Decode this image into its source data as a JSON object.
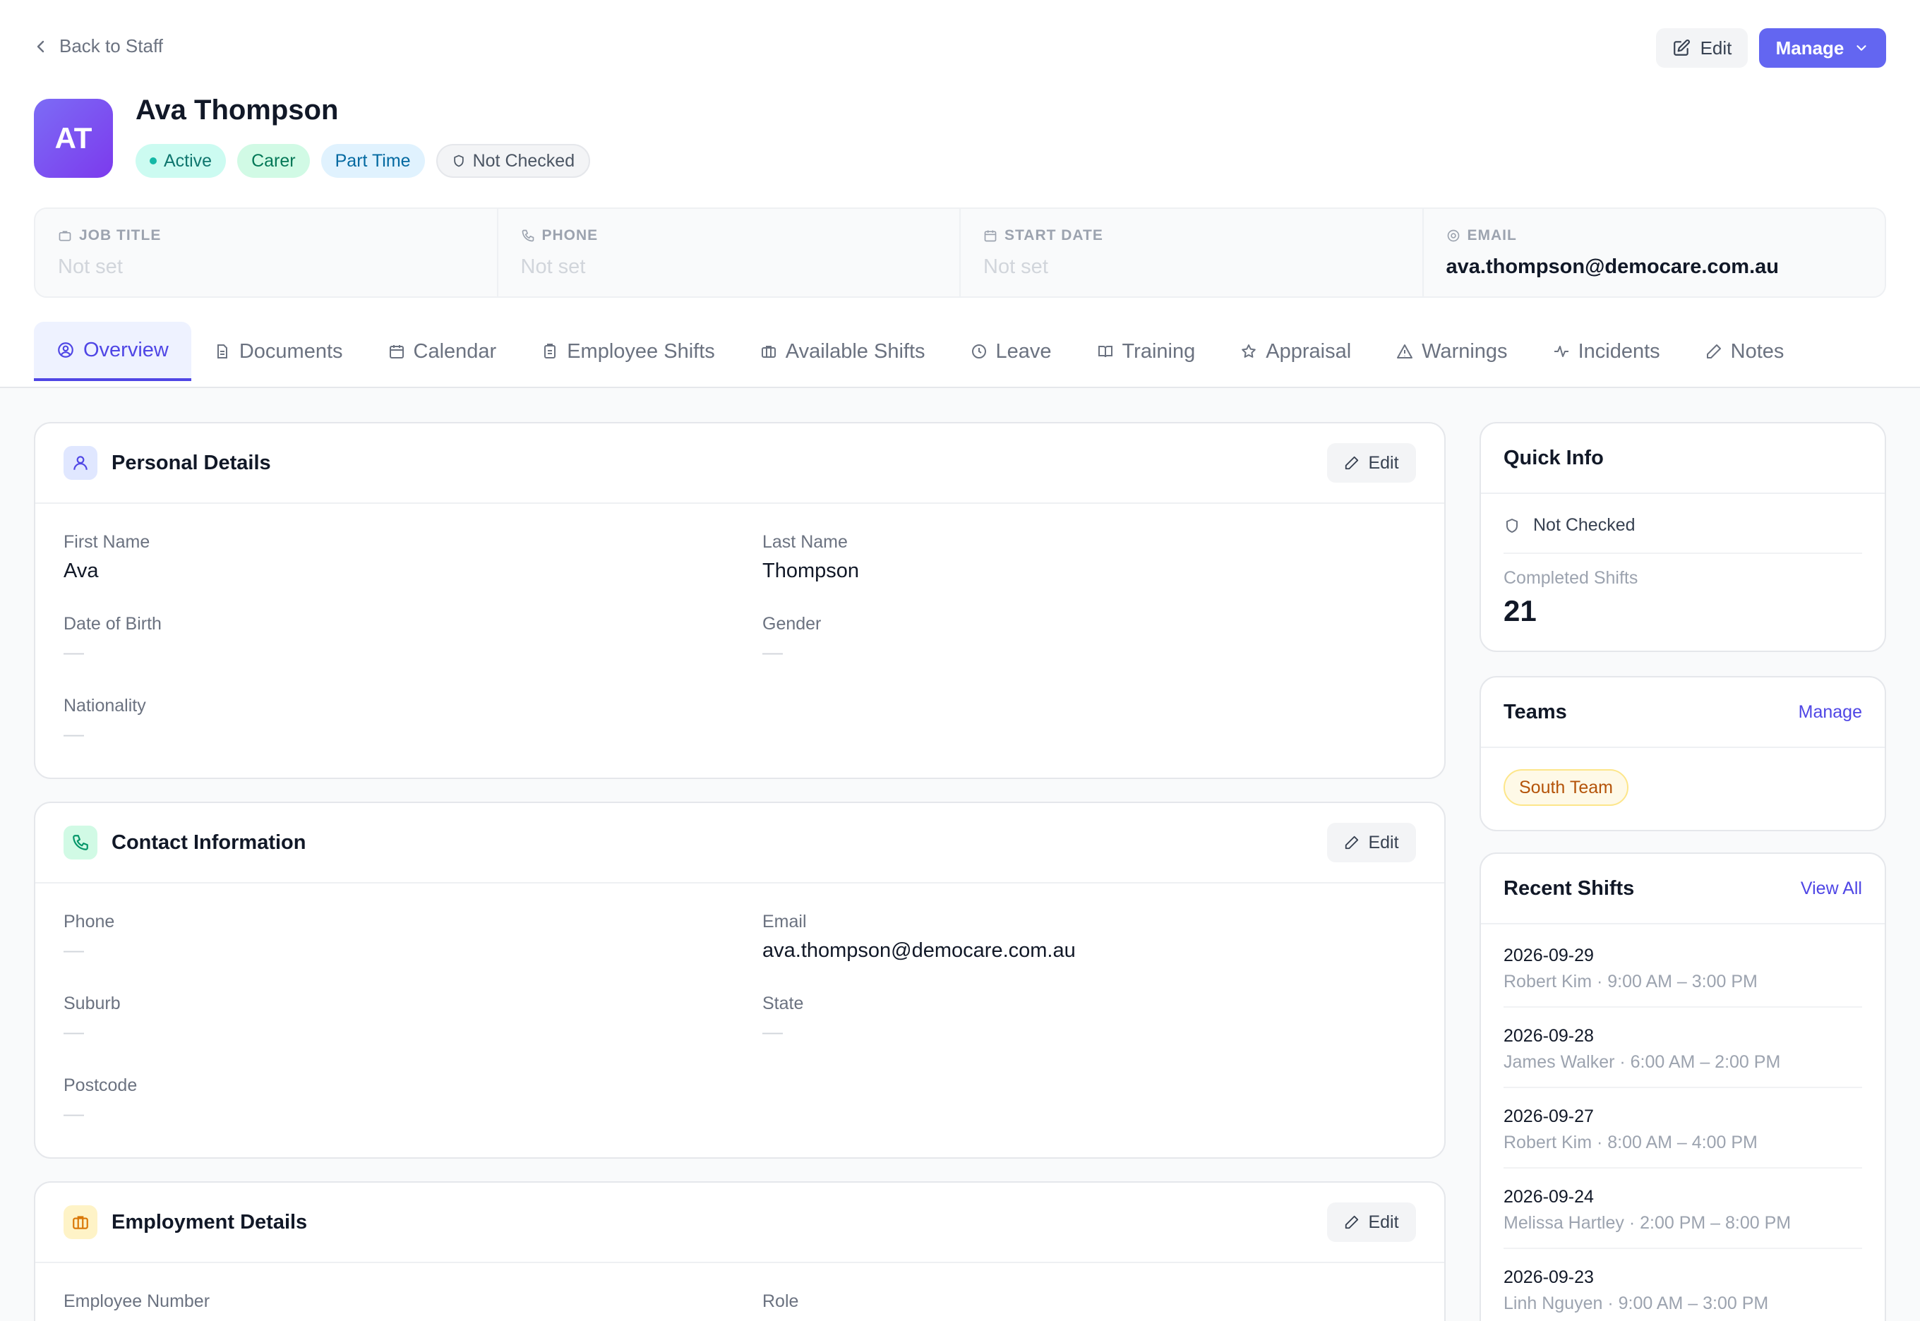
{
  "nav": {
    "back_label": "Back to Staff"
  },
  "header_actions": {
    "edit_label": "Edit",
    "manage_label": "Manage"
  },
  "profile": {
    "initials": "AT",
    "name": "Ava Thompson",
    "badges": {
      "active": "Active",
      "carer": "Carer",
      "part_time": "Part Time",
      "check": "Not Checked"
    }
  },
  "info": {
    "job_title": {
      "label": "JOB TITLE",
      "value": "Not set"
    },
    "phone": {
      "label": "PHONE",
      "value": "Not set"
    },
    "start_date": {
      "label": "START DATE",
      "value": "Not set"
    },
    "email": {
      "label": "EMAIL",
      "value": "ava.thompson@democare.com.au"
    }
  },
  "tabs": [
    "Overview",
    "Documents",
    "Calendar",
    "Employee Shifts",
    "Available Shifts",
    "Leave",
    "Training",
    "Appraisal",
    "Warnings",
    "Incidents",
    "Notes"
  ],
  "personal": {
    "title": "Personal Details",
    "edit_label": "Edit",
    "first_name": {
      "label": "First Name",
      "value": "Ava"
    },
    "last_name": {
      "label": "Last Name",
      "value": "Thompson"
    },
    "dob": {
      "label": "Date of Birth",
      "value": "—"
    },
    "gender": {
      "label": "Gender",
      "value": "—"
    },
    "nationality": {
      "label": "Nationality",
      "value": "—"
    }
  },
  "contact": {
    "title": "Contact Information",
    "edit_label": "Edit",
    "phone": {
      "label": "Phone",
      "value": "—"
    },
    "email": {
      "label": "Email",
      "value": "ava.thompson@democare.com.au"
    },
    "suburb": {
      "label": "Suburb",
      "value": "—"
    },
    "state": {
      "label": "State",
      "value": "—"
    },
    "postcode": {
      "label": "Postcode",
      "value": "—"
    }
  },
  "employment": {
    "title": "Employment Details",
    "edit_label": "Edit",
    "employee_number": {
      "label": "Employee Number"
    },
    "role": {
      "label": "Role"
    }
  },
  "quick_info": {
    "title": "Quick Info",
    "check_status": "Not Checked",
    "completed_label": "Completed Shifts",
    "completed_value": "21"
  },
  "teams": {
    "title": "Teams",
    "manage_label": "Manage",
    "team": "South Team"
  },
  "recent_shifts": {
    "title": "Recent Shifts",
    "view_all": "View All",
    "items": [
      {
        "date": "2026-09-29",
        "desc": "Robert Kim · 9:00 AM – 3:00 PM"
      },
      {
        "date": "2026-09-28",
        "desc": "James Walker · 6:00 AM – 2:00 PM"
      },
      {
        "date": "2026-09-27",
        "desc": "Robert Kim · 8:00 AM – 4:00 PM"
      },
      {
        "date": "2026-09-24",
        "desc": "Melissa Hartley · 2:00 PM – 8:00 PM"
      },
      {
        "date": "2026-09-23",
        "desc": "Linh Nguyen · 9:00 AM – 3:00 PM"
      }
    ]
  },
  "colors": {
    "primary": "#6366f1",
    "active_tab": "#4f46e5"
  }
}
